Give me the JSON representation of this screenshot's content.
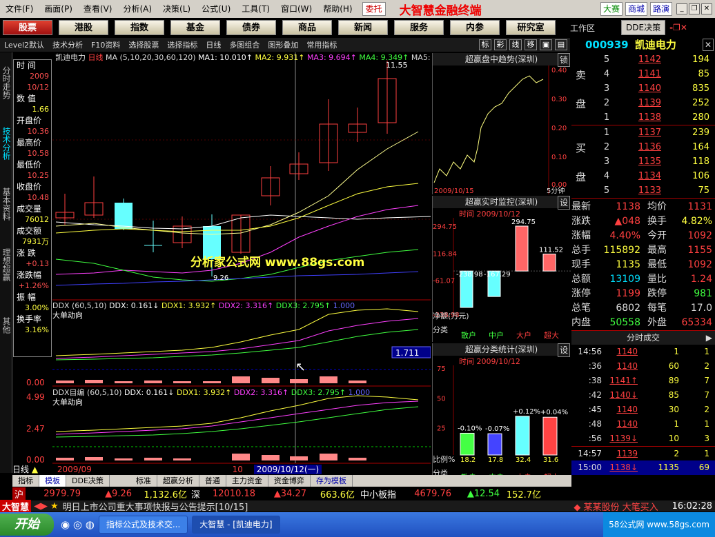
{
  "menu": [
    "文件(F)",
    "画面(P)",
    "查看(V)",
    "分析(A)",
    "决策(L)",
    "公式(U)",
    "工具(T)",
    "窗口(W)",
    "帮助(H)"
  ],
  "entrust": "委托",
  "brand": "大智慧金融终端",
  "menu_right": [
    "大赛",
    "商城",
    "路演"
  ],
  "nav": [
    "股票",
    "港股",
    "指数",
    "基金",
    "债券",
    "商品",
    "新闻",
    "服务",
    "内参",
    "研究室"
  ],
  "workspace": "工作区",
  "dde_btn": "DDE决策",
  "toolbar": [
    "Level2默认",
    "技术分析",
    "F10资料",
    "选择股票",
    "选择指标",
    "日线",
    "多图组合",
    "图形叠加",
    "常用指标"
  ],
  "toolbar_icons": [
    "标",
    "彩",
    "线",
    "移"
  ],
  "stock": {
    "code": "000939",
    "name": "凯迪电力"
  },
  "left_tabs": [
    "分时走势",
    "技术分析",
    "基本资料",
    "理想超赢",
    "其他"
  ],
  "info": [
    {
      "l": "时  间",
      "v": "2009"
    },
    {
      "l": "",
      "v": "10/12"
    },
    {
      "l": "数  值",
      "v": "1.66"
    },
    {
      "l": "开盘价",
      "v": "10.36"
    },
    {
      "l": "最高价",
      "v": "10.58"
    },
    {
      "l": "最低价",
      "v": "10.25"
    },
    {
      "l": "收盘价",
      "v": "10.48"
    },
    {
      "l": "成交量",
      "v": "76012"
    },
    {
      "l": "成交额",
      "v": "7931万"
    },
    {
      "l": "涨  跌",
      "v": "+0.13"
    },
    {
      "l": "涨跌幅",
      "v": "+1.26%"
    },
    {
      "l": "振  幅",
      "v": "3.00%"
    },
    {
      "l": "换手率",
      "v": "3.16%"
    }
  ],
  "main_legend": {
    "name": "凯迪电力",
    "period": "日线",
    "ma": "MA (5,10,20,30,60,120)",
    "ma1": "MA1: 10.010↑",
    "ma2": "MA2: 9.931↑",
    "ma3": "MA3: 9.694↑",
    "ma4": "MA4: 9.349↑",
    "ma5": "MA5:"
  },
  "high_label": "11.55",
  "low_label": "9.26",
  "watermark": "分析家公式网  www.88gs.com",
  "ddx1": {
    "title": "DDX (60,5,10)",
    "ddx": "DDX: 0.161↓",
    "d1": "DDX1: 3.932↑",
    "d2": "DDX2: 3.316↑",
    "d3": "DDX3: 2.795↑",
    "base": "1.000",
    "sub": "大单动向",
    "val": "1.711",
    "axis": "0.00"
  },
  "ddx2": {
    "title": "DDX目编 (60,5,10)",
    "ddx": "DDX: 0.161↓",
    "d1": "DDX1: 3.932↑",
    "d2": "DDX2: 3.316↑",
    "d3": "DDX3: 2.795↑",
    "base": "1.000",
    "sub": "大单动向",
    "axis_top": "4.99",
    "axis_mid": "2.47",
    "axis_bot": "0.00"
  },
  "date_bar": {
    "period": "日线",
    "left": "2009/09",
    "mid": "10",
    "cursor": "2009/10/12(一)"
  },
  "p1": {
    "title": "超赢盘中趋势(深圳)",
    "btn": "锁",
    "ticks": [
      "0.40",
      "0.30",
      "0.20",
      "0.10",
      "0.00"
    ],
    "date": "2009/10/15",
    "unit": "5分钟"
  },
  "p2": {
    "title": "超赢实时监控(深圳)",
    "btn": "设",
    "time": "时间 2009/10/12",
    "ticks": [
      "294.75",
      "116.84",
      "-61.07"
    ],
    "bottom_tick": "-238.98",
    "unit": "净额(万元)",
    "cats": [
      "散户",
      "中户",
      "大户",
      "超大"
    ],
    "cat_label": "分类",
    "values": [
      -238.98,
      -167.29,
      294.75,
      111.52
    ],
    "labels": [
      "-238.98",
      "-167.29",
      "294.75",
      "111.52"
    ]
  },
  "p3": {
    "title": "超赢分类统计(深圳)",
    "btn": "设",
    "time": "时间 2009/10/12",
    "ticks": [
      "75",
      "50",
      "25"
    ],
    "cats": [
      "散户",
      "中户",
      "大户",
      "超大"
    ],
    "cat_label": "分类",
    "ratio_label": "比例%",
    "values": [
      18.2,
      17.8,
      32.4,
      31.6
    ],
    "pct": [
      "18.2",
      "17.8",
      "32.4",
      "31.6"
    ],
    "chg": [
      "-0.10%",
      "-0.07%",
      "+0.12%",
      "+0.04%"
    ]
  },
  "sell": [
    {
      "n": "5",
      "p": "1142",
      "v": "194"
    },
    {
      "n": "4",
      "p": "1141",
      "v": "85"
    },
    {
      "n": "3",
      "p": "1140",
      "v": "835"
    },
    {
      "n": "2",
      "p": "1139",
      "v": "252"
    },
    {
      "n": "1",
      "p": "1138",
      "v": "280"
    }
  ],
  "buy": [
    {
      "n": "1",
      "p": "1137",
      "v": "239"
    },
    {
      "n": "2",
      "p": "1136",
      "v": "164"
    },
    {
      "n": "3",
      "p": "1135",
      "v": "118"
    },
    {
      "n": "4",
      "p": "1134",
      "v": "106"
    },
    {
      "n": "5",
      "p": "1133",
      "v": "75"
    }
  ],
  "sell_label": [
    "卖",
    "盘"
  ],
  "buy_label": [
    "买",
    "盘"
  ],
  "stats": [
    {
      "a": "最新",
      "b": "1138",
      "c": "均价",
      "d": "1131"
    },
    {
      "a": "涨跌",
      "b": "▲048",
      "c": "换手",
      "d": "4.82%"
    },
    {
      "a": "涨幅",
      "b": "4.40%",
      "c": "今开",
      "d": "1092"
    },
    {
      "a": "总手",
      "b": "115892",
      "c": "最高",
      "d": "1155"
    },
    {
      "a": "现手",
      "b": "1135",
      "c": "最低",
      "d": "1092"
    },
    {
      "a": "总额",
      "b": "13109",
      "c": "量比",
      "d": "1.24"
    },
    {
      "a": "涨停",
      "b": "1199",
      "c": "跌停",
      "d": "981"
    },
    {
      "a": "总笔",
      "b": "6802",
      "c": "每笔",
      "d": "17.0"
    },
    {
      "a": "内盘",
      "b": "50558",
      "c": "外盘",
      "d": "65334"
    }
  ],
  "ticks_title": "分时成交",
  "ticks": [
    {
      "t": "14:56",
      "p": "1140",
      "v": "1",
      "c": "1"
    },
    {
      "t": ":36",
      "p": "1140",
      "v": "60",
      "c": "2"
    },
    {
      "t": ":38",
      "p": "1141↑",
      "v": "89",
      "c": "7"
    },
    {
      "t": ":42",
      "p": "1140↓",
      "v": "85",
      "c": "7"
    },
    {
      "t": ":45",
      "p": "1140",
      "v": "30",
      "c": "2"
    },
    {
      "t": ":48",
      "p": "1140",
      "v": "1",
      "c": "1"
    },
    {
      "t": ":56",
      "p": "1139↓",
      "v": "10",
      "c": "3"
    },
    {
      "t": "14:57",
      "p": "1139",
      "v": "2",
      "c": "1"
    },
    {
      "t": "15:00",
      "p": "1138↓",
      "v": "1135",
      "c": "69"
    }
  ],
  "bottom_tabs": [
    "指标",
    "模板",
    "DDE决策",
    "标准",
    "超赢分析",
    "普通",
    "主力资金",
    "资金博弈",
    "存为模板"
  ],
  "index": {
    "sh": "沪",
    "sh_v": "2979.79",
    "sh_c": "▲9.26",
    "sh_a": "1,132.6亿",
    "sz": "深",
    "sz_v": "12010.18",
    "sz_c": "▲34.27",
    "sz_a": "663.6亿",
    "zx": "中小板指",
    "zx_v": "4679.76",
    "zx_c": "▲12.54",
    "zx_a": "152.7亿"
  },
  "news": {
    "logo": "大智慧",
    "text": "明日上市公司重大事项快报与公告提示[10/15]",
    "right": "◆ 某某股份 大笔买入",
    "time": "16:02:28"
  },
  "taskbar": {
    "start": "开始",
    "t1": "指标公式及技术交...",
    "t2": "大智慧 - [凯迪电力]",
    "tray": "58公式网 www.58gs.com"
  }
}
